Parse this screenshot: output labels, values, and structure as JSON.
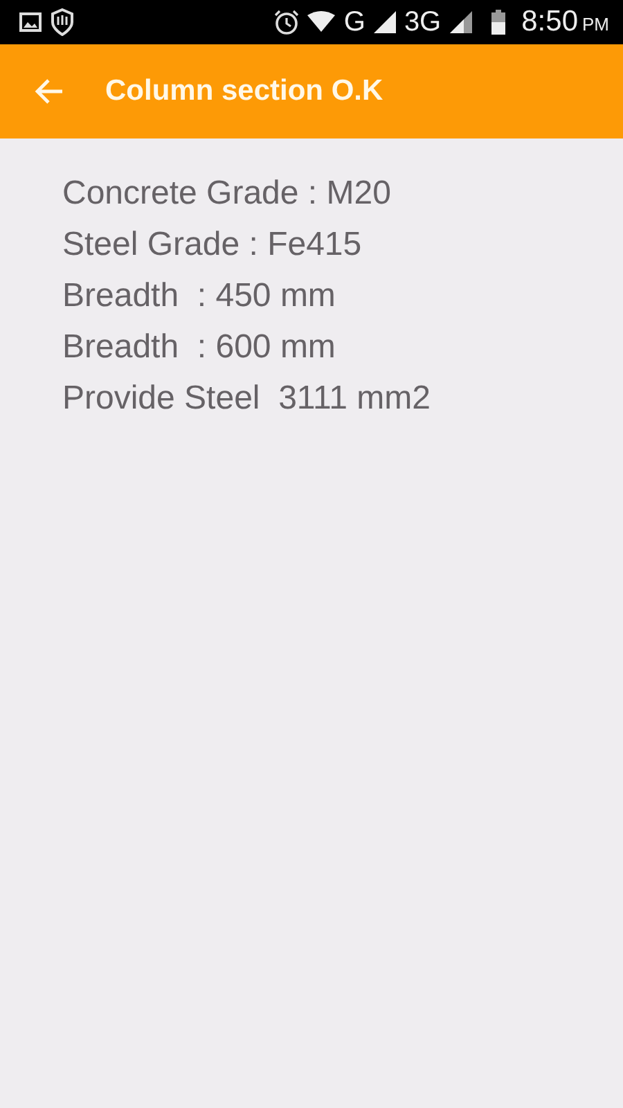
{
  "status_bar": {
    "network_labels": [
      "G",
      "3G"
    ],
    "time": "8:50",
    "period": "PM"
  },
  "app_bar": {
    "title": "Column section O.K"
  },
  "lines": [
    "Concrete Grade : M20",
    "Steel Grade : Fe415",
    "Breadth  : 450 mm",
    "Breadth  : 600 mm",
    "Provide Steel  3111 mm2"
  ]
}
